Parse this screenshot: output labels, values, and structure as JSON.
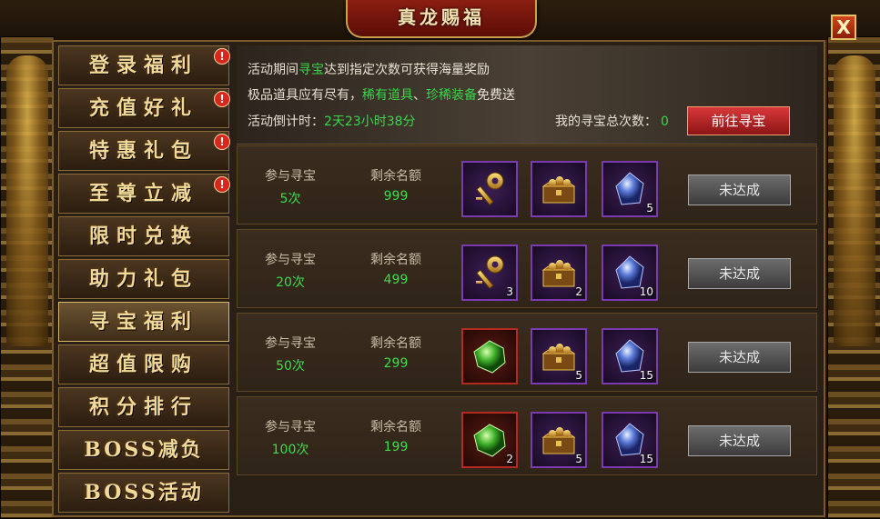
{
  "window": {
    "title": "真龙赐福",
    "close_label": "X"
  },
  "sidebar": {
    "items": [
      {
        "label": "登录福利",
        "badge": "!"
      },
      {
        "label": "充值好礼",
        "badge": "!"
      },
      {
        "label": "特惠礼包",
        "badge": "!"
      },
      {
        "label": "至尊立减",
        "badge": "!"
      },
      {
        "label": "限时兑换",
        "badge": ""
      },
      {
        "label": "助力礼包",
        "badge": ""
      },
      {
        "label": "寻宝福利",
        "badge": "",
        "active": true
      },
      {
        "label": "超值限购",
        "badge": ""
      },
      {
        "label": "积分排行",
        "badge": ""
      },
      {
        "label": "BOSS减负",
        "badge": ""
      },
      {
        "label": "BOSS活动",
        "badge": ""
      }
    ]
  },
  "banner": {
    "line1_a": "活动期间",
    "line1_hl": "寻宝",
    "line1_b": "达到指定次数可获得海量奖励",
    "line2_a": "极品道具应有尽有，",
    "line2_hl1": "稀有道具",
    "line2_sep": "、",
    "line2_hl2": "珍稀装备",
    "line2_b": "免费送",
    "countdown_label": "活动倒计时：",
    "countdown_value": "2天23小时38分",
    "total_label": "我的寻宝总次数：",
    "total_value": "0",
    "go_button": "前往寻宝"
  },
  "rows": {
    "cap_times": "参与寻宝",
    "cap_remain": "剩余名额",
    "items": [
      {
        "times": "5次",
        "remain": "999",
        "rewards": [
          {
            "icon": "golden-key-icon",
            "count": ""
          },
          {
            "icon": "treasure-chest-icon",
            "count": ""
          },
          {
            "icon": "blue-crystal-icon",
            "count": "5"
          }
        ],
        "button": "未达成"
      },
      {
        "times": "20次",
        "remain": "499",
        "rewards": [
          {
            "icon": "golden-key-icon",
            "count": "3"
          },
          {
            "icon": "treasure-chest-icon",
            "count": "2"
          },
          {
            "icon": "blue-crystal-icon",
            "count": "10"
          }
        ],
        "button": "未达成"
      },
      {
        "times": "50次",
        "remain": "299",
        "rewards": [
          {
            "icon": "green-gem-icon",
            "count": ""
          },
          {
            "icon": "treasure-chest-icon",
            "count": "5"
          },
          {
            "icon": "blue-crystal-icon",
            "count": "15"
          }
        ],
        "button": "未达成"
      },
      {
        "times": "100次",
        "remain": "199",
        "rewards": [
          {
            "icon": "green-gem-icon",
            "count": "2"
          },
          {
            "icon": "treasure-chest-icon",
            "count": "5"
          },
          {
            "icon": "blue-crystal-icon",
            "count": "15"
          }
        ],
        "button": "未达成"
      }
    ]
  },
  "colors": {
    "highlight": "#39d64a",
    "badge": "#d9261c",
    "accent_gold": "#d8b768"
  }
}
